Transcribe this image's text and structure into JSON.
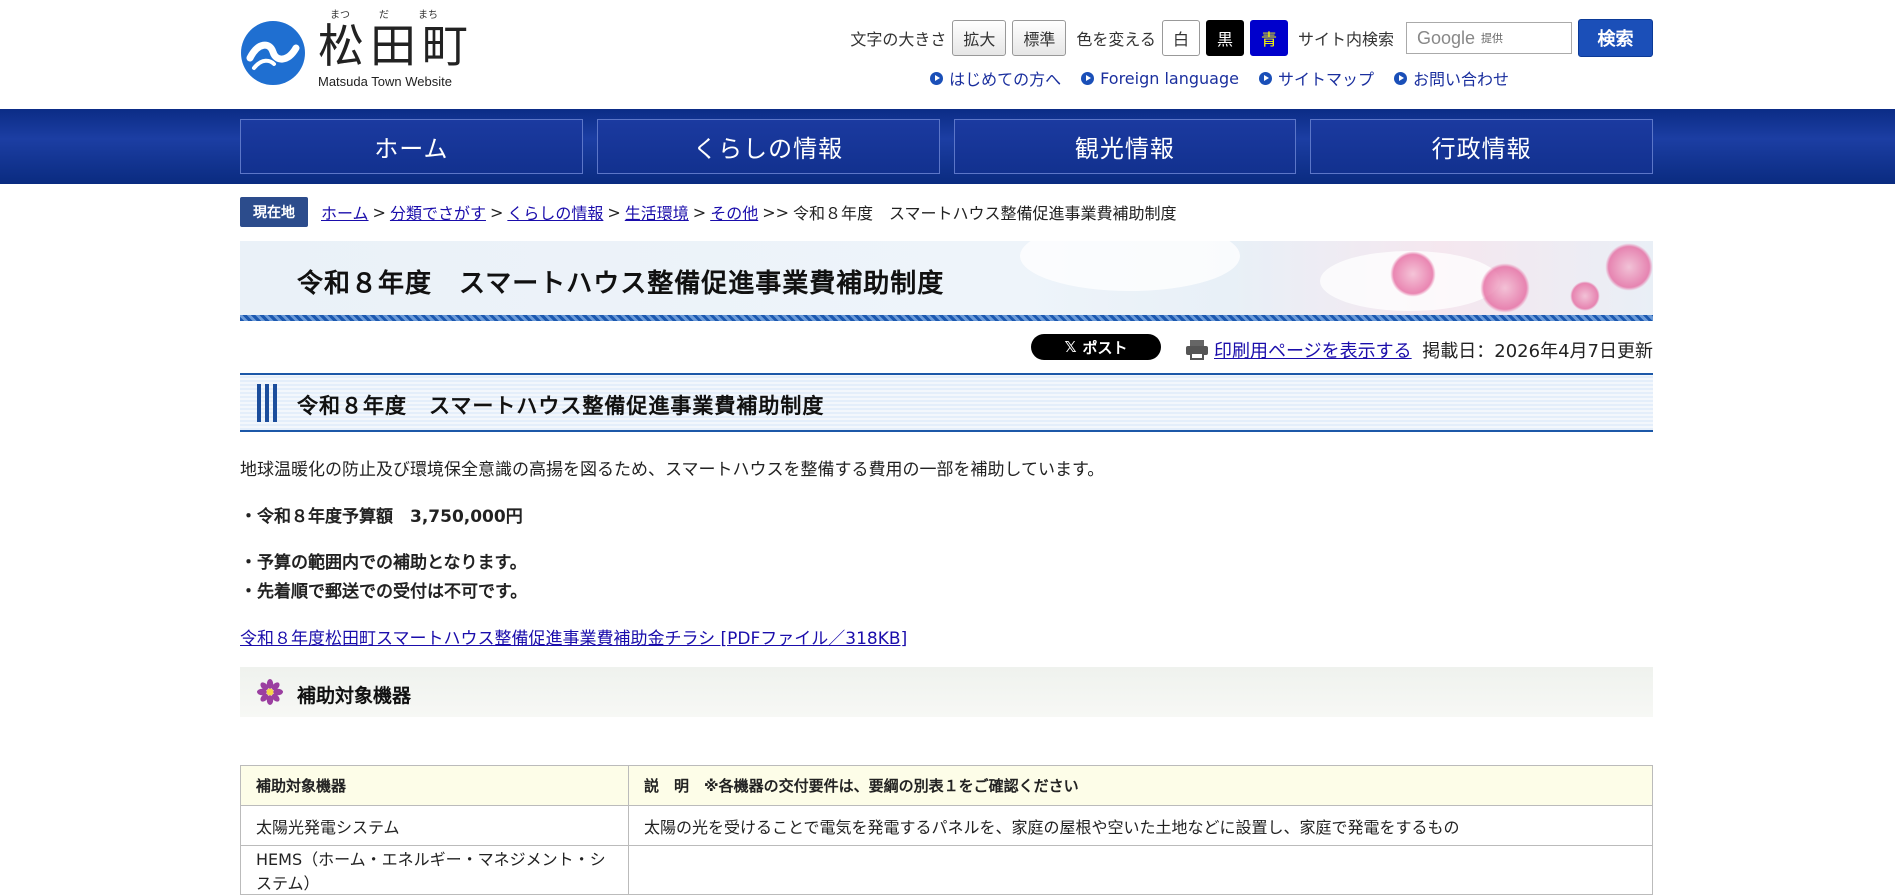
{
  "header": {
    "logo_ruby": [
      "まつ",
      "だ",
      "まち"
    ],
    "logo_title": "松田町",
    "logo_subtitle": "Matsuda Town Website",
    "font_size_label": "文字の大きさ",
    "font_size_large": "拡大",
    "font_size_normal": "標準",
    "color_label": "色を変える",
    "color_white": "白",
    "color_black": "黒",
    "color_blue": "青",
    "site_search_label": "サイト内検索",
    "search_placeholder_brand": "Google",
    "search_placeholder_suffix": "提供",
    "search_button": "検索",
    "sublinks": [
      "はじめての方へ",
      "Foreign language",
      "サイトマップ",
      "お問い合わせ"
    ]
  },
  "nav": [
    "ホーム",
    "くらしの情報",
    "観光情報",
    "行政情報"
  ],
  "breadcrumb": {
    "tag": "現在地",
    "links": [
      "ホーム",
      "分類でさがす",
      "くらしの情報",
      "生活環境",
      "その他"
    ],
    "current": "令和８年度　スマートハウス整備促進事業費補助制度"
  },
  "page_title": "令和８年度　スマートハウス整備促進事業費補助制度",
  "actions": {
    "x_post": "ポスト",
    "print_link": "印刷用ページを表示する",
    "date": "掲載日：2026年4月7日更新"
  },
  "section": {
    "heading": "令和８年度　スマートハウス整備促進事業費補助制度",
    "intro": "地球温暖化の防止及び環境保全意識の高揚を図るため、スマートハウスを整備する費用の一部を補助しています。",
    "budget": "・令和８年度予算額　3,750,000円",
    "note1": "・予算の範囲内での補助となります。",
    "note2": "・先着順で郵送での受付は不可です。",
    "pdf_link": "令和８年度松田町スマートハウス整備促進事業費補助金チラシ [PDFファイル／318KB]"
  },
  "subsection": {
    "heading": "補助対象機器",
    "icon": "flower-icon",
    "table": {
      "headers": [
        "補助対象機器",
        "説　明　※各機器の交付要件は、要綱の別表１をご確認ください"
      ],
      "rows": [
        [
          "太陽光発電システム",
          "太陽の光を受けることで電気を発電するパネルを、家庭の屋根や空いた土地などに設置し、家庭で発電をするもの"
        ],
        [
          "HEMS（ホーム・エネルギー・マネジメント・システム）",
          ""
        ]
      ]
    }
  },
  "colors": {
    "nav_blue": "#1b3aa0",
    "search_button": "#1b4fb8",
    "breadcrumb_tag": "#2c4c8c",
    "flower_purple": "#9b3fa0"
  }
}
